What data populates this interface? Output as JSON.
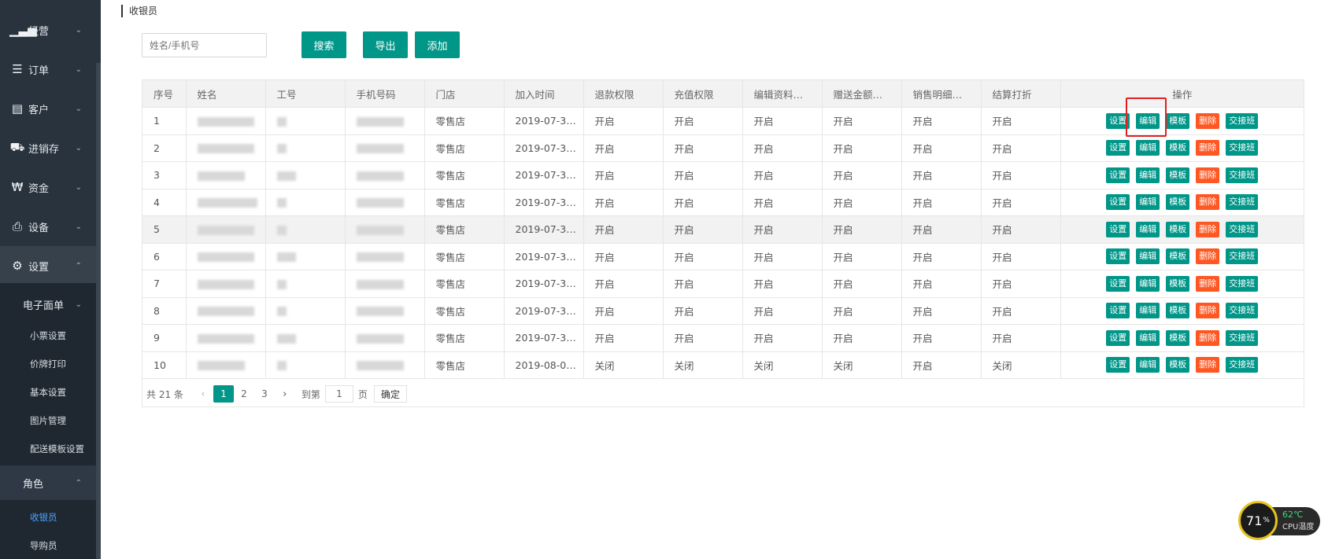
{
  "sidebar": {
    "menus": [
      {
        "label": "经营",
        "icon": "bar-chart-icon"
      },
      {
        "label": "订单",
        "icon": "list-icon"
      },
      {
        "label": "客户",
        "icon": "id-card-icon"
      },
      {
        "label": "进销存",
        "icon": "truck-icon"
      },
      {
        "label": "资金",
        "icon": "currency-icon"
      },
      {
        "label": "设备",
        "icon": "printer-icon"
      },
      {
        "label": "设置",
        "icon": "gear-icon"
      }
    ],
    "sub_group1": "电子面单",
    "sub_items1": [
      "小票设置",
      "价牌打印",
      "基本设置",
      "图片管理",
      "配送模板设置"
    ],
    "sub_group2": "角色",
    "sub_items2": [
      "收银员",
      "导购员"
    ]
  },
  "breadcrumb": "收银员",
  "search": {
    "placeholder": "姓名/手机号"
  },
  "toolbar": {
    "search_label": "搜索",
    "export_label": "导出",
    "add_label": "添加"
  },
  "table": {
    "headers": [
      "序号",
      "姓名",
      "工号",
      "手机号码",
      "门店",
      "加入时间",
      "退款权限",
      "充值权限",
      "编辑资料…",
      "赠送金额…",
      "销售明细…",
      "结算打折",
      "操作"
    ],
    "ops": [
      "设置",
      "编辑",
      "模板",
      "删除",
      "交接班"
    ],
    "rows": [
      {
        "no": "1",
        "store": "零售店",
        "time": "2019-07-3…",
        "p1": "开启",
        "p2": "开启",
        "p3": "开启",
        "p4": "开启",
        "p5": "开启",
        "p6": "开启"
      },
      {
        "no": "2",
        "store": "零售店",
        "time": "2019-07-3…",
        "p1": "开启",
        "p2": "开启",
        "p3": "开启",
        "p4": "开启",
        "p5": "开启",
        "p6": "开启"
      },
      {
        "no": "3",
        "store": "零售店",
        "time": "2019-07-3…",
        "p1": "开启",
        "p2": "开启",
        "p3": "开启",
        "p4": "开启",
        "p5": "开启",
        "p6": "开启"
      },
      {
        "no": "4",
        "store": "零售店",
        "time": "2019-07-3…",
        "p1": "开启",
        "p2": "开启",
        "p3": "开启",
        "p4": "开启",
        "p5": "开启",
        "p6": "开启"
      },
      {
        "no": "5",
        "store": "零售店",
        "time": "2019-07-3…",
        "p1": "开启",
        "p2": "开启",
        "p3": "开启",
        "p4": "开启",
        "p5": "开启",
        "p6": "开启"
      },
      {
        "no": "6",
        "store": "零售店",
        "time": "2019-07-3…",
        "p1": "开启",
        "p2": "开启",
        "p3": "开启",
        "p4": "开启",
        "p5": "开启",
        "p6": "开启"
      },
      {
        "no": "7",
        "store": "零售店",
        "time": "2019-07-3…",
        "p1": "开启",
        "p2": "开启",
        "p3": "开启",
        "p4": "开启",
        "p5": "开启",
        "p6": "开启"
      },
      {
        "no": "8",
        "store": "零售店",
        "time": "2019-07-3…",
        "p1": "开启",
        "p2": "开启",
        "p3": "开启",
        "p4": "开启",
        "p5": "开启",
        "p6": "开启"
      },
      {
        "no": "9",
        "store": "零售店",
        "time": "2019-07-3…",
        "p1": "开启",
        "p2": "开启",
        "p3": "开启",
        "p4": "开启",
        "p5": "开启",
        "p6": "开启"
      },
      {
        "no": "10",
        "store": "零售店",
        "time": "2019-08-0…",
        "p1": "关闭",
        "p2": "关闭",
        "p3": "关闭",
        "p4": "关闭",
        "p5": "开启",
        "p6": "关闭"
      }
    ]
  },
  "pager": {
    "total": "共 21 条",
    "pages": [
      "1",
      "2",
      "3"
    ],
    "goto_label": "到第",
    "goto_value": "1",
    "page_unit": "页",
    "confirm": "确定"
  },
  "cpu": {
    "percent": "71",
    "unit": "%",
    "temp": "62℃",
    "label": "CPU温度"
  },
  "colors": {
    "primary": "#009688",
    "danger": "#ff5722",
    "sidebar_bg": "#28333e",
    "highlight": "#e02020"
  }
}
